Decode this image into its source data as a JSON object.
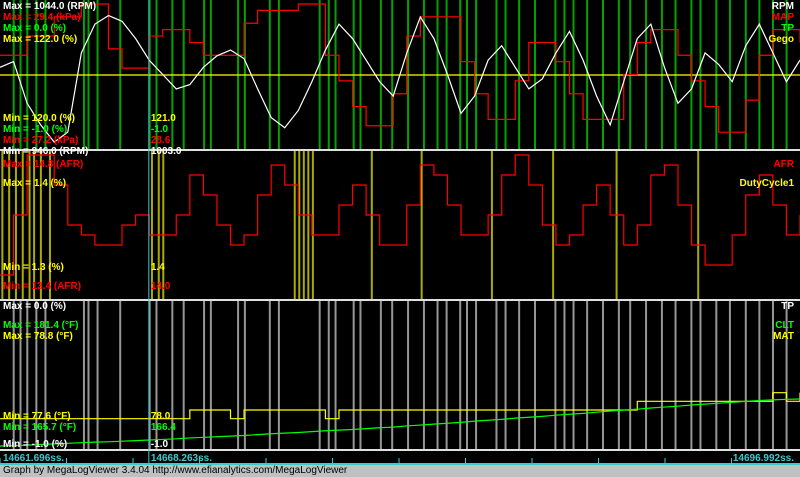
{
  "chart_data": {
    "type": "line",
    "title": "MegaLogViewer log graph",
    "time_range_s": [
      14661.696,
      14696.992
    ],
    "cursor_time_s": 14668.263,
    "time_labels": {
      "start": "14661.696ss.",
      "cursor": "14668.263ss.",
      "end": "14696.992ss."
    },
    "panels": [
      {
        "name": "panel-1",
        "series": [
          {
            "name": "RPM",
            "color": "#ffffff",
            "min": 946.0,
            "max": 1044.0,
            "cursor": "1003.0",
            "min_label": "Min = 946.0 (RPM)",
            "max_label": "Max = 1044.0 (RPM)",
            "values": [
              1000,
              1004,
              975,
              960,
              948,
              955,
              1010,
              1030,
              1036,
              1032,
              1020,
              1005,
              995,
              985,
              988,
              1000,
              1008,
              1012,
              1006,
              985,
              965,
              958,
              970,
              990,
              1012,
              1030,
              1020,
              1005,
              990,
              980,
              1010,
              1035,
              1020,
              995,
              968,
              980,
              1005,
              1015,
              1000,
              985,
              992,
              1010,
              1025,
              1005,
              980,
              960,
              990,
              1020,
              1030,
              1000,
              975,
              985,
              1010,
              1002,
              990,
              1015,
              1030,
              1010,
              990,
              1005
            ]
          },
          {
            "name": "MAP",
            "color": "#ff0000",
            "min": 27.2,
            "max": 29.4,
            "cursor": "28.6",
            "min_label": "Min = 27.2 (kPa)",
            "max_label": "Max = 29.4 (kPa)",
            "values": [
              28.6,
              28.6,
              28.9,
              28.9,
              29.2,
              29.2,
              29.4,
              29.4,
              28.7,
              28.4,
              28.4,
              28.9,
              29.0,
              29.0,
              28.8,
              28.6,
              28.6,
              28.6,
              29.1,
              29.3,
              29.3,
              29.3,
              29.4,
              29.4,
              28.6,
              28.2,
              27.8,
              27.5,
              27.5,
              28.0,
              28.9,
              29.2,
              29.2,
              29.2,
              28.5,
              28.0,
              27.6,
              27.6,
              28.2,
              28.8,
              28.8,
              28.5,
              28.0,
              27.6,
              27.6,
              27.6,
              28.3,
              28.8,
              29.0,
              29.0,
              28.6,
              28.2,
              27.8,
              27.4,
              27.4,
              27.9,
              28.6,
              29.0,
              29.0,
              28.8
            ]
          },
          {
            "name": "TP",
            "color": "#00ff00",
            "min": -1.0,
            "max": 0.0,
            "cursor": "-1.0",
            "min_label": "Min = -1.0 (%)",
            "max_label": "Max = 0.0 (%)"
          },
          {
            "name": "Gego",
            "color": "#ffff00",
            "min": 120.0,
            "max": 122.0,
            "cursor": "121.0",
            "min_label": "Min = 120.0 (%)",
            "max_label": "Max = 122.0 (%)",
            "values": [
              121,
              121
            ]
          }
        ]
      },
      {
        "name": "panel-2",
        "series": [
          {
            "name": "AFR",
            "color": "#ff0000",
            "min": 13.4,
            "max": 14.8,
            "cursor": "14.0",
            "min_label": "Min = 13.4 (AFR)",
            "max_label": "Max = 14.8 (AFR)",
            "values": [
              13.6,
              14.2,
              14.8,
              14.8,
              14.5,
              14.1,
              14.0,
              13.9,
              13.9,
              14.1,
              14.2,
              14.0,
              14.0,
              14.2,
              14.6,
              14.4,
              14.1,
              13.9,
              14.0,
              14.4,
              14.7,
              14.5,
              14.2,
              14.0,
              14.0,
              14.3,
              14.5,
              14.2,
              13.9,
              13.9,
              14.3,
              14.7,
              14.6,
              14.3,
              14.0,
              14.0,
              14.2,
              14.6,
              14.8,
              14.5,
              14.1,
              13.9,
              14.0,
              14.3,
              14.5,
              14.2,
              13.9,
              14.1,
              14.6,
              14.7,
              14.3,
              13.9,
              13.7,
              13.7,
              14.0,
              14.4,
              14.6,
              14.3,
              14.0,
              14.2
            ]
          },
          {
            "name": "DutyCycle1",
            "color": "#ffff00",
            "min": 1.3,
            "max": 1.4,
            "cursor": "1.4",
            "min_label": "Min = 1.3 (%)",
            "max_label": "Max = 1.4 (%)"
          }
        ]
      },
      {
        "name": "panel-3",
        "series": [
          {
            "name": "TP",
            "color": "#ffffff",
            "min": -1.0,
            "max": 0.0,
            "cursor": "-1.0",
            "min_label": "Min = -1.0 (%)",
            "max_label": "Max = 0.0 (%)"
          },
          {
            "name": "CLT",
            "color": "#00ff00",
            "min": 165.7,
            "max": 181.4,
            "cursor": "166.4",
            "min_label": "Min = 165.7 (°F)",
            "max_label": "Max = 181.4 (°F)",
            "values": [
              165.7,
              165.8,
              166.0,
              166.2,
              166.4,
              166.6,
              166.8,
              167.0,
              167.1,
              167.3,
              167.5,
              167.7,
              167.9,
              168.1,
              168.4,
              168.6,
              168.8,
              169.0,
              169.2,
              169.5,
              169.8,
              170.0,
              170.2,
              170.5,
              170.8,
              171.0,
              171.2,
              171.5,
              171.8,
              172.0,
              172.4,
              172.7,
              173.0,
              173.3,
              173.6,
              174.0,
              174.3,
              174.6,
              175.0,
              175.3,
              175.6,
              176.0,
              176.3,
              176.6,
              177.0,
              177.4,
              177.7,
              178.0,
              178.4,
              178.7,
              179.0,
              179.4,
              179.7,
              180.0,
              180.3,
              180.6,
              180.9,
              181.1,
              181.3,
              181.4
            ]
          },
          {
            "name": "MAT",
            "color": "#ffff00",
            "min": 77.6,
            "max": 78.8,
            "cursor": "78.0",
            "min_label": "Min = 77.6 (°F)",
            "max_label": "Max = 78.8 (°F)",
            "values": [
              78.0,
              78.0,
              78.0,
              78.0,
              78.0,
              78.0,
              78.0,
              78.0,
              78.0,
              78.0,
              78.0,
              78.0,
              78.0,
              78.0,
              78.2,
              78.2,
              78.2,
              78.0,
              78.2,
              78.2,
              78.2,
              78.2,
              78.2,
              78.2,
              78.0,
              78.2,
              78.2,
              78.2,
              78.2,
              78.2,
              78.2,
              78.2,
              78.2,
              78.2,
              78.2,
              78.2,
              78.2,
              78.2,
              78.2,
              78.2,
              78.2,
              78.2,
              78.2,
              78.2,
              78.2,
              78.2,
              78.2,
              78.4,
              78.4,
              78.4,
              78.4,
              78.4,
              78.4,
              78.4,
              78.4,
              78.4,
              78.4,
              78.6,
              78.4,
              78.6
            ]
          }
        ]
      }
    ],
    "tp_spike_times_s": [
      14662.3,
      14662.6,
      14662.9,
      14663.3,
      14663.7,
      14665.4,
      14665.6,
      14666.0,
      14667.0,
      14668.3,
      14668.6,
      14669.3,
      14669.8,
      14670.7,
      14671.0,
      14672.2,
      14672.5,
      14673.6,
      14674.0,
      14675.8,
      14676.2,
      14676.5,
      14677.3,
      14677.6,
      14678.5,
      14679.0,
      14679.7,
      14680.4,
      14681.0,
      14681.4,
      14682.0,
      14682.3,
      14682.7,
      14683.6,
      14684.0,
      14684.6,
      14685.3,
      14686.2,
      14686.6,
      14687.0,
      14687.6,
      14688.3,
      14689.0,
      14689.5,
      14690.2,
      14690.9,
      14691.5,
      14692.2,
      14692.6,
      14693.3,
      14693.9,
      14694.6,
      14695.2,
      14695.8,
      14696.4
    ],
    "duty_spike_times_s": [
      14661.8,
      14662.1,
      14662.4,
      14662.7,
      14663.0,
      14663.2,
      14663.5,
      14663.9,
      14668.4,
      14668.7,
      14668.9,
      14674.7,
      14674.9,
      14675.1,
      14675.3,
      14675.5,
      14678.1,
      14680.3,
      14683.4,
      14686.1,
      14688.9,
      14692.5
    ],
    "footer": "Graph by MegaLogViewer 3.4.04 http://www.efianalytics.com/MegaLogViewer"
  }
}
